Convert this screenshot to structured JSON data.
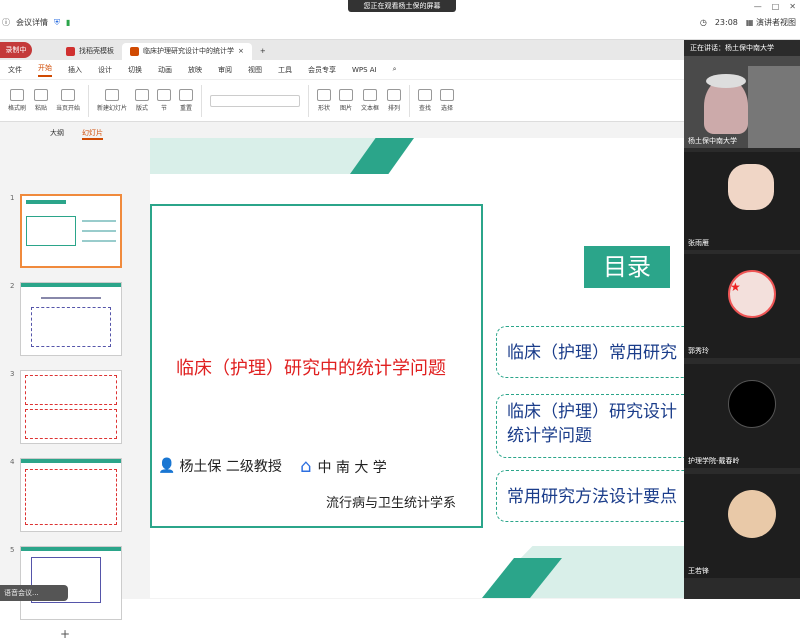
{
  "meeting": {
    "left_items": [
      "会议详情"
    ],
    "share_notice": "您正在观看杨土保的屏幕",
    "time": "23:08",
    "view_mode": "演讲者视图",
    "win_controls": [
      "—",
      "□",
      "✕"
    ]
  },
  "ppt": {
    "recording": "录制中",
    "tabs": [
      {
        "label": "找稻壳模板",
        "color": "#d0302f"
      },
      {
        "label": "临床护理研究设计中的统计学",
        "color": "#d04a02"
      }
    ],
    "menu": [
      "文件",
      "开始",
      "插入",
      "设计",
      "切换",
      "动画",
      "放映",
      "审阅",
      "视图",
      "工具",
      "会员专享",
      "WPS AI"
    ],
    "active_menu": "开始",
    "ribbon": [
      "格式刷",
      "粘贴",
      "当页开始",
      "新建幻灯片",
      "版式",
      "节",
      "重置",
      "形状",
      "图片",
      "文本框",
      "排列",
      "查找",
      "选择"
    ],
    "panel_tabs": [
      "大纲",
      "幻灯片"
    ],
    "thumb_numbers": [
      "1",
      "2",
      "3",
      "4",
      "5"
    ],
    "add_slide": "+",
    "voice": "语音会议..."
  },
  "slide": {
    "title": "临床（护理）研究中的统计学问题",
    "author": "杨土保  二级教授",
    "university": "中  南  大  学",
    "department": "流行病与卫生统计学系",
    "toc_title": "目录",
    "toc_items": [
      "临床（护理）常用研究",
      "临床（护理）研究设计 统计学问题",
      "常用研究方法设计要点"
    ]
  },
  "participants": {
    "speaking": "正在讲话：杨土保中南大学",
    "list": [
      {
        "name": "杨土保中南大学"
      },
      {
        "name": "张雨雁"
      },
      {
        "name": "郭秀玲"
      },
      {
        "name": "护理学院-戴春岭"
      },
      {
        "name": "王若锋"
      }
    ]
  },
  "colors": {
    "accent": "#2ba58a",
    "title_red": "#e02020",
    "toc_blue": "#1a3c8a",
    "wps_orange": "#d04a02"
  }
}
